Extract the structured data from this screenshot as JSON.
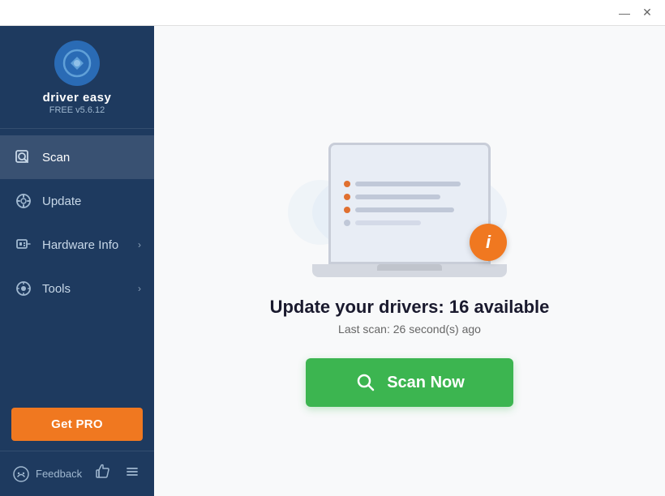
{
  "window": {
    "minimize_label": "—",
    "close_label": "✕"
  },
  "sidebar": {
    "logo": {
      "title": "driver easy",
      "version": "FREE v5.6.12"
    },
    "nav_items": [
      {
        "id": "scan",
        "label": "Scan",
        "icon": "scan-icon",
        "active": true,
        "has_arrow": false
      },
      {
        "id": "update",
        "label": "Update",
        "icon": "update-icon",
        "active": false,
        "has_arrow": false
      },
      {
        "id": "hardware-info",
        "label": "Hardware Info",
        "icon": "hardware-icon",
        "active": false,
        "has_arrow": true
      },
      {
        "id": "tools",
        "label": "Tools",
        "icon": "tools-icon",
        "active": false,
        "has_arrow": true
      }
    ],
    "get_pro_label": "Get PRO",
    "footer": {
      "feedback_label": "Feedback"
    }
  },
  "content": {
    "main_title": "Update your drivers: 16 available",
    "sub_text": "Last scan: 26 second(s) ago",
    "scan_button_label": "Scan Now"
  }
}
